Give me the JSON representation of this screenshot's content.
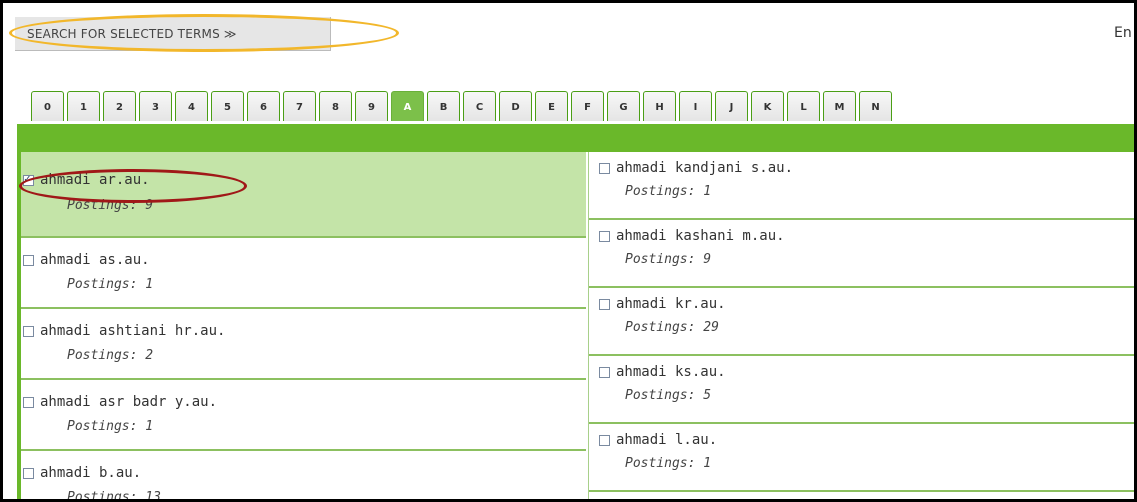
{
  "search_button": {
    "label": "SEARCH FOR SELECTED TERMS ≫"
  },
  "top_right_link": "En",
  "tabs": [
    "0",
    "1",
    "2",
    "3",
    "4",
    "5",
    "6",
    "7",
    "8",
    "9",
    "A",
    "B",
    "C",
    "D",
    "E",
    "F",
    "G",
    "H",
    "I",
    "J",
    "K",
    "L",
    "M",
    "N"
  ],
  "active_tab": "A",
  "left_column": [
    {
      "term": "ahmadi ar.au.",
      "postings": "Postings: 9",
      "checked": true
    },
    {
      "term": "ahmadi as.au.",
      "postings": "Postings: 1",
      "checked": false
    },
    {
      "term": "ahmadi ashtiani hr.au.",
      "postings": "Postings: 2",
      "checked": false
    },
    {
      "term": "ahmadi asr badr y.au.",
      "postings": "Postings: 1",
      "checked": false
    },
    {
      "term": "ahmadi b.au.",
      "postings": "Postings: 13",
      "checked": false
    }
  ],
  "right_column": [
    {
      "term": "ahmadi kandjani s.au.",
      "postings": "Postings: 1",
      "checked": false
    },
    {
      "term": "ahmadi kashani m.au.",
      "postings": "Postings: 9",
      "checked": false
    },
    {
      "term": "ahmadi kr.au.",
      "postings": "Postings: 29",
      "checked": false
    },
    {
      "term": "ahmadi ks.au.",
      "postings": "Postings: 5",
      "checked": false
    },
    {
      "term": "ahmadi l.au.",
      "postings": "Postings: 1",
      "checked": false
    }
  ],
  "colors": {
    "accent_green": "#6ab82a",
    "selected_row": "#c4e4a8",
    "highlight_orange": "#f2b72b",
    "highlight_red": "#a01818"
  }
}
